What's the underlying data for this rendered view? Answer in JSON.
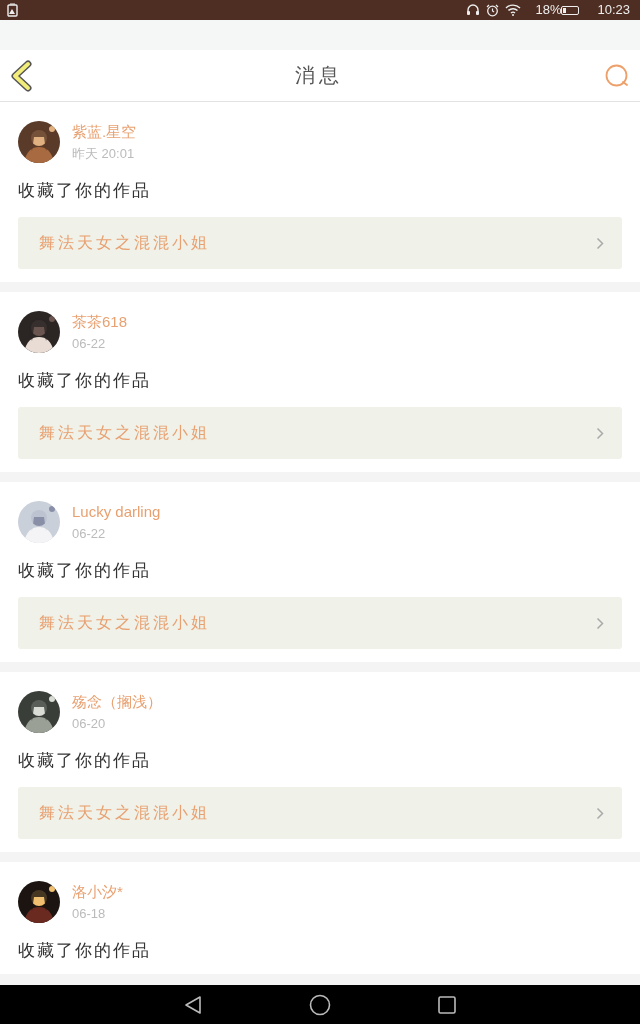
{
  "status_bar": {
    "battery_percent": "18%",
    "time": "10:23"
  },
  "header": {
    "title": "消息"
  },
  "messages": [
    {
      "user": "紫蓝.星空",
      "time": "昨天 20:01",
      "action": "收藏了你的作品",
      "work": "舞法天女之混混小姐"
    },
    {
      "user": "茶茶618",
      "time": "06-22",
      "action": "收藏了你的作品",
      "work": "舞法天女之混混小姐"
    },
    {
      "user": "Lucky darling",
      "time": "06-22",
      "action": "收藏了你的作品",
      "work": "舞法天女之混混小姐"
    },
    {
      "user": "殇念（搁浅）",
      "time": "06-20",
      "action": "收藏了你的作品",
      "work": "舞法天女之混混小姐"
    },
    {
      "user": "洛小汐*",
      "time": "06-18",
      "action": "收藏了你的作品"
    }
  ]
}
